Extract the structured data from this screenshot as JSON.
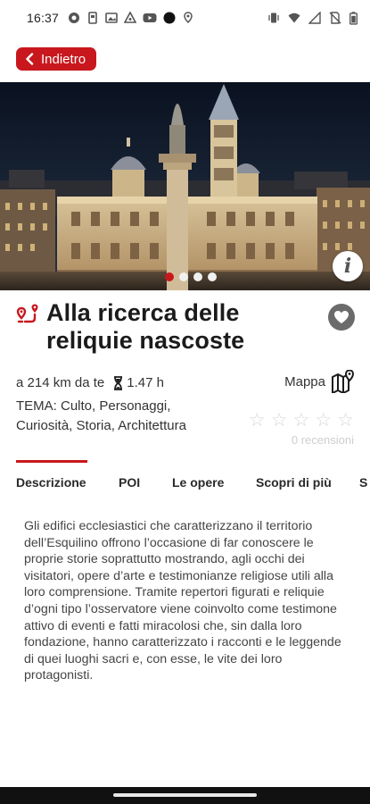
{
  "status_bar": {
    "time": "16:37",
    "left_icons": [
      "android-logo-icon",
      "gallery-icon",
      "image-icon",
      "triangle-app-icon",
      "youtube-icon",
      "circle-app-icon",
      "location-pin-icon"
    ],
    "right_icons": [
      "vibrate-icon",
      "wifi-icon",
      "signal-icon",
      "no-sim-icon",
      "battery-icon"
    ]
  },
  "header": {
    "back_label": "Indietro"
  },
  "gallery": {
    "image": "basilica-night-photo",
    "dots": [
      true,
      false,
      false,
      false
    ],
    "info_label": "i"
  },
  "detail": {
    "title": "Alla ricerca delle reliquie nascoste",
    "distance": "a 214 km da te",
    "duration": "1.47 h",
    "map_label": "Mappa",
    "theme": "TEMA: Culto, Personaggi, Curiosità, Storia, Architettura",
    "rating_stars": 0,
    "reviews": "0 recensioni"
  },
  "tabs": [
    {
      "label": "Descrizione",
      "active": true
    },
    {
      "label": "POI",
      "active": false
    },
    {
      "label": "Le opere",
      "active": false
    },
    {
      "label": "Scopri di più",
      "active": false
    },
    {
      "label": "S",
      "active": false
    }
  ],
  "description": "Gli edifici ecclesiastici che caratterizzano il territorio dell’Esquilino offrono l’occasione di far conoscere le proprie storie soprattutto mostrando, agli occhi dei visitatori, opere d’arte e testimonianze religiose utili alla loro comprensione. Tramite repertori figurati e reliquie d’ogni tipo l’osservatore viene coinvolto come testimone attivo di eventi e fatti miracolosi che, sin dalla loro fondazione, hanno caratterizzato i racconti e le leggende di quei luoghi sacri e, con esse, le vite dei loro protagonisti.",
  "colors": {
    "accent": "#c8181e",
    "text": "#222222",
    "muted": "#cfcfcf"
  }
}
